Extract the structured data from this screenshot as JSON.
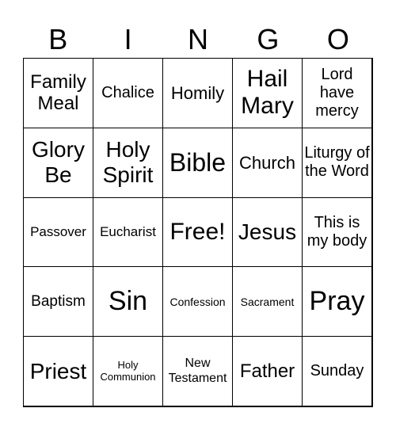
{
  "header": [
    "B",
    "I",
    "N",
    "G",
    "O"
  ],
  "cells": [
    "Family Meal",
    "Chalice",
    "Homily",
    "Hail Mary",
    "Lord have mercy",
    "Glory Be",
    "Holy Spirit",
    "Bible",
    "Church",
    "Liturgy of the Word",
    "Passover",
    "Eucharist",
    "Free!",
    "Jesus",
    "This is my body",
    "Baptism",
    "Sin",
    "Confession",
    "Sacrament",
    "Pray",
    "Priest",
    "Holy Communion",
    "New Testament",
    "Father",
    "Sunday"
  ]
}
